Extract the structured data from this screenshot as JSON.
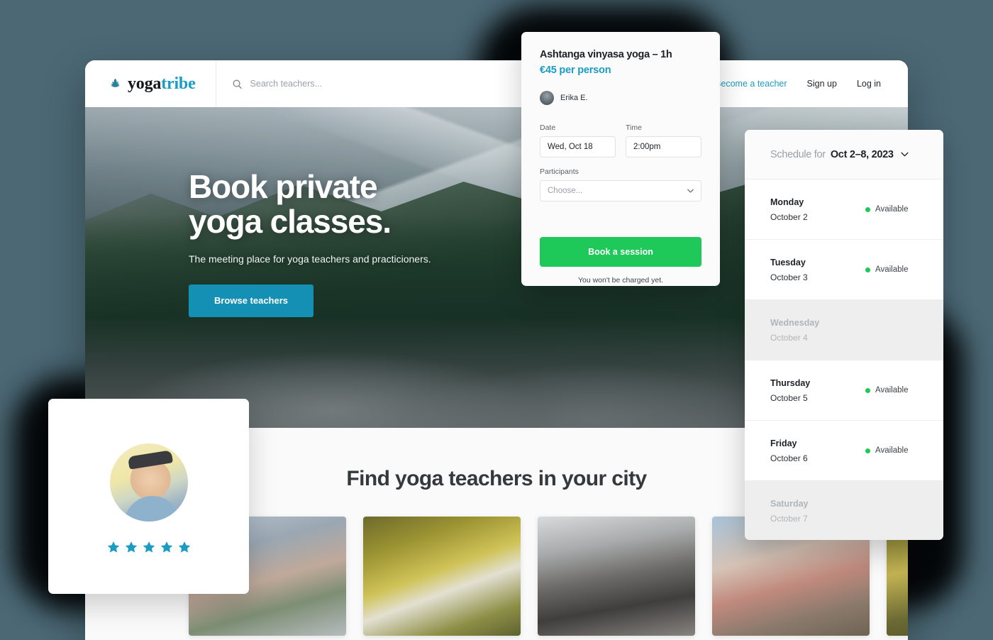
{
  "theme": {
    "background": "#4b6874",
    "accent_teal": "#1a9cc4",
    "hero_button": "#1490b4",
    "green": "#1ec95a",
    "star": "#1a9cc4"
  },
  "navbar": {
    "logo": {
      "icon": "lotus-icon",
      "text_primary": "yoga",
      "text_accent": "tribe"
    },
    "search": {
      "icon": "search-icon",
      "placeholder": "Search teachers...",
      "value": ""
    },
    "links": [
      {
        "label": "+ Become a teacher",
        "accent": true
      },
      {
        "label": "Sign up",
        "accent": false
      },
      {
        "label": "Log in",
        "accent": false
      }
    ]
  },
  "hero": {
    "title_line1": "Book private",
    "title_line2": "yoga classes.",
    "subtitle": "The meeting place for yoga teachers and practicioners.",
    "button_label": "Browse teachers"
  },
  "teachers_section": {
    "title": "Find yoga teachers in your city",
    "cards": [
      {
        "name": "teacher-card-rooftop-city"
      },
      {
        "name": "teacher-card-forward-fold"
      },
      {
        "name": "teacher-card-balance-pose"
      },
      {
        "name": "teacher-card-helsinki-tram"
      },
      {
        "name": "teacher-card-outdoor"
      }
    ]
  },
  "booking_card": {
    "title": "Ashtanga vinyasa yoga – 1h",
    "price": "€45 per person",
    "teacher": {
      "avatar": "teacher-avatar",
      "name": "Erika E."
    },
    "date_label": "Date",
    "date_value": "Wed, Oct 18",
    "time_label": "Time",
    "time_value": "2:00pm",
    "participants_label": "Participants",
    "participants_placeholder": "Choose...",
    "cta_label": "Book a session",
    "note": "You won't be charged yet."
  },
  "schedule": {
    "header_label": "Schedule for",
    "header_range": "Oct 2–8, 2023",
    "rows": [
      {
        "day": "Monday",
        "date": "October 2",
        "status": "Available",
        "available": true
      },
      {
        "day": "Tuesday",
        "date": "October 3",
        "status": "Available",
        "available": true
      },
      {
        "day": "Wednesday",
        "date": "October 4",
        "status": "",
        "available": false
      },
      {
        "day": "Thursday",
        "date": "October 5",
        "status": "Available",
        "available": true
      },
      {
        "day": "Friday",
        "date": "October 6",
        "status": "Available",
        "available": true
      },
      {
        "day": "Saturday",
        "date": "October 7",
        "status": "",
        "available": false
      }
    ]
  },
  "review_card": {
    "avatar": "reviewer-avatar",
    "rating": 5,
    "stars_total": 5
  }
}
